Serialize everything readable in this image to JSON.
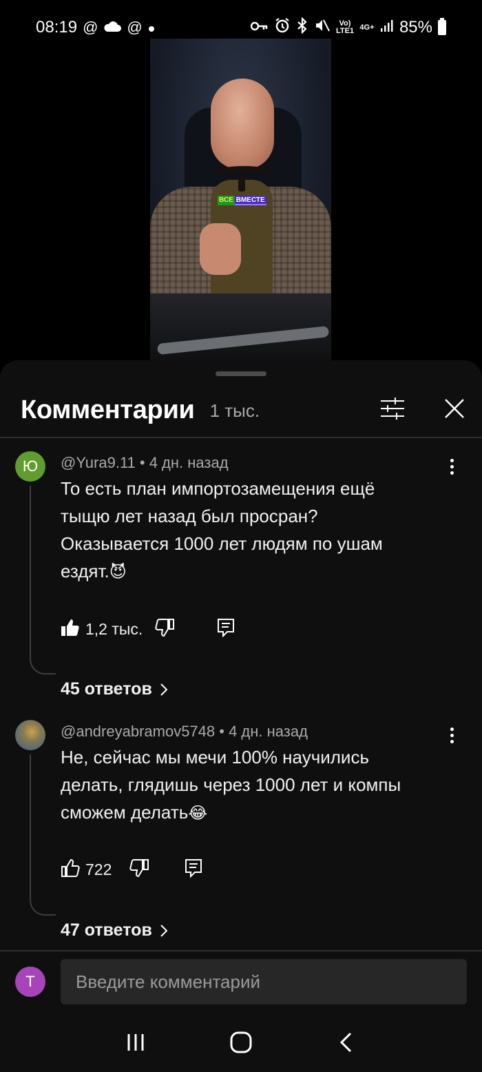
{
  "status_bar": {
    "time": "08:19",
    "left_icons": [
      "at-icon",
      "cloud-icon",
      "at-icon",
      "dot-icon"
    ],
    "right_icons": [
      "key-icon",
      "alarm-icon",
      "bluetooth-icon",
      "mute-icon",
      "volte-icon",
      "4g-icon",
      "signal-icon"
    ],
    "volte_label": "Vo) LTE1",
    "network_label": "4G+",
    "battery": "85%"
  },
  "video": {
    "caption_word1": "ВСЕ",
    "caption_word2": "ВМЕСТЕ"
  },
  "comments_panel": {
    "title": "Комментарии",
    "count": "1 тыс.",
    "comments": [
      {
        "avatar_letter": "Ю",
        "avatar_color": "#5f9e2e",
        "author": "@Yura9.11",
        "time": "4 дн. назад",
        "meta": "@Yura9.11 • 4 дн. назад",
        "text_lines": [
          "То есть план импортозамещения ещё",
          "тыщю лет назад был просран?",
          "Оказывается 1000 лет людям по ушам",
          "ездят."
        ],
        "emoji": "😈",
        "likes": "1,2 тыс.",
        "liked": true,
        "replies": "45 ответов"
      },
      {
        "avatar_letter": "",
        "author": "@andreyabramov5748",
        "time": "4 дн. назад",
        "meta": "@andreyabramov5748 • 4 дн. назад",
        "text_lines": [
          "Не, сейчас мы мечи 100% научились",
          "делать, глядишь через 1000 лет и компы",
          "сможем делать"
        ],
        "emoji": "😂",
        "likes": "722",
        "liked": false,
        "replies": "47 ответов"
      }
    ]
  },
  "compose": {
    "avatar_letter": "Т",
    "avatar_color": "#a744b9",
    "placeholder": "Введите комментарий"
  },
  "nav_bar": {
    "buttons": [
      "recent-apps-icon",
      "home-icon",
      "back-icon"
    ]
  }
}
